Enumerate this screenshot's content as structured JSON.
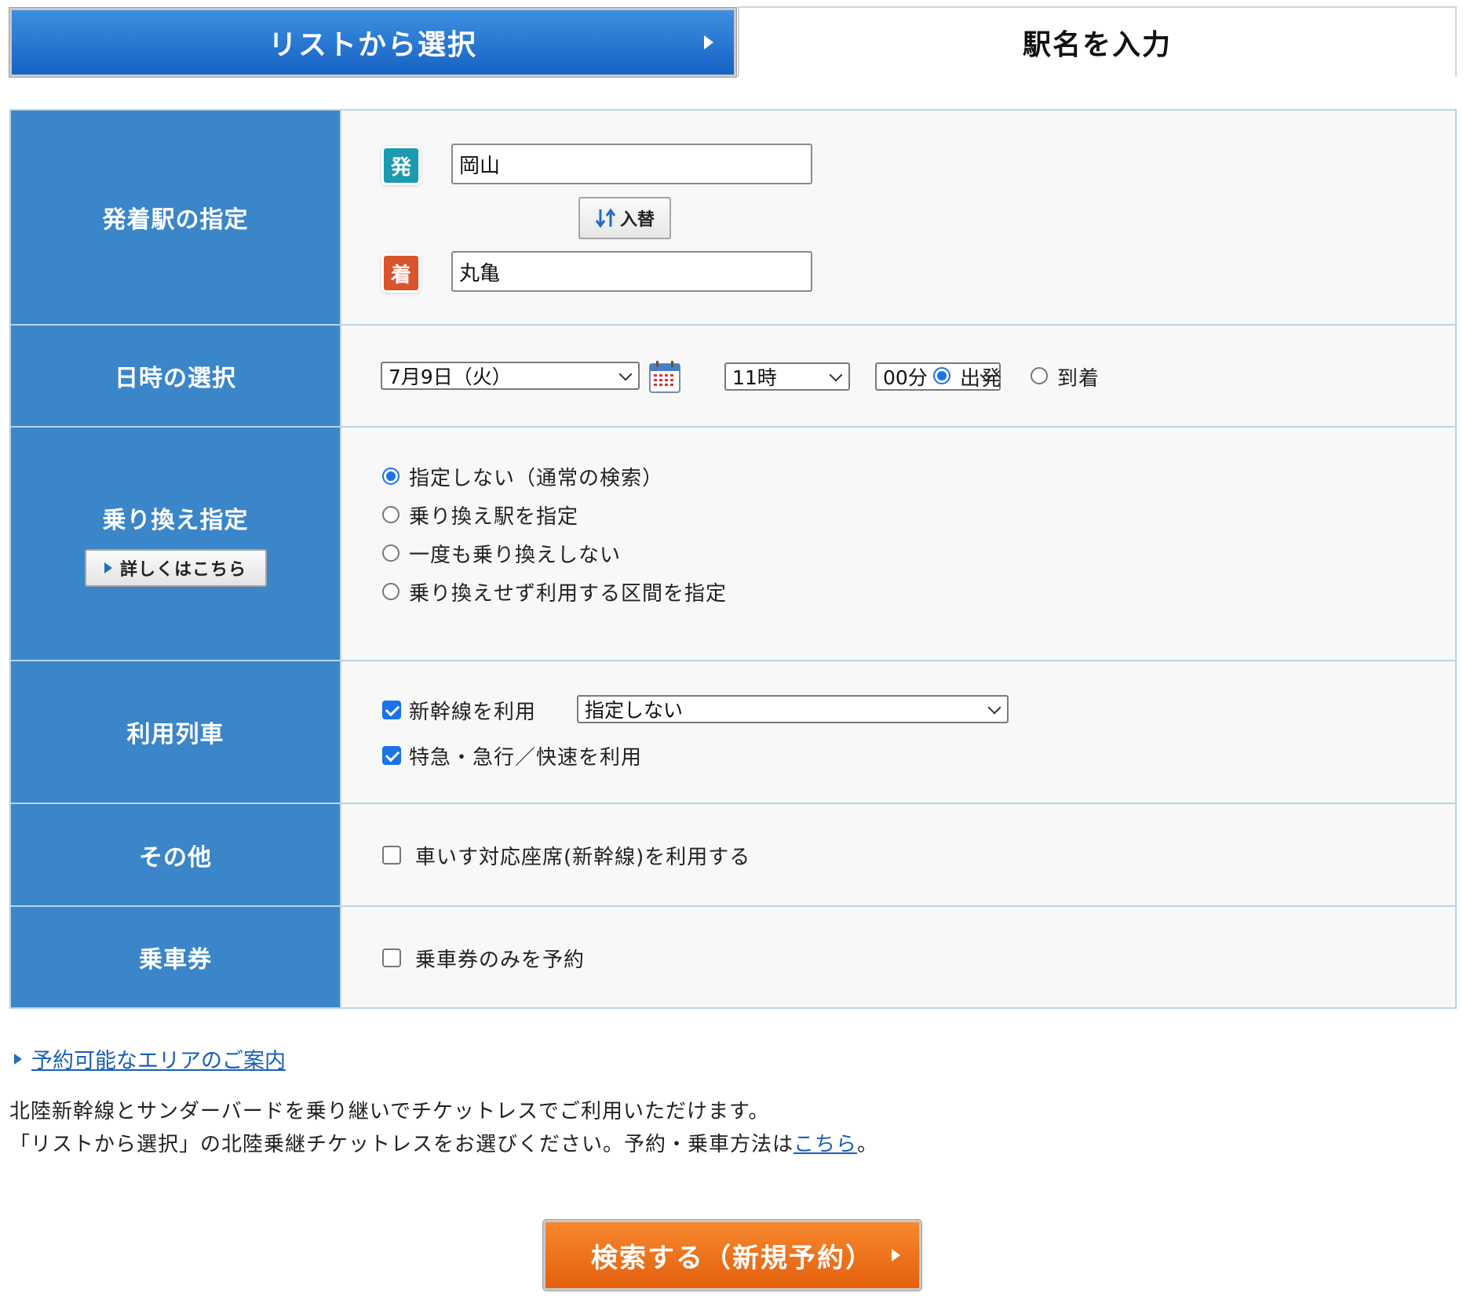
{
  "tabs": {
    "list_select": "リストから選択",
    "enter_station": "駅名を入力"
  },
  "stations": {
    "heading": "発着駅の指定",
    "dep_badge": "発",
    "arr_badge": "着",
    "departure": "岡山",
    "arrival": "丸亀",
    "swap_label": "入替",
    "colors": {
      "dep_badge": "#1a9bb0",
      "arr_badge": "#d9532b"
    }
  },
  "datetime": {
    "heading": "日時の選択",
    "date": "7月9日（火）",
    "hour": "11時",
    "minute": "00分",
    "mode_depart": "出発",
    "mode_arrive": "到着",
    "selected_mode": "出発"
  },
  "transfer": {
    "heading": "乗り換え指定",
    "detail_button": "詳しくはこちら",
    "options": [
      "指定しない（通常の検索）",
      "乗り換え駅を指定",
      "一度も乗り換えしない",
      "乗り換えせず利用する区間を指定"
    ],
    "selected_index": 0
  },
  "trains": {
    "heading": "利用列車",
    "shinkansen_label": "新幹線を利用",
    "shinkansen_checked": true,
    "shinkansen_select": "指定しない",
    "limited_label": "特急・急行／快速を利用",
    "limited_checked": true
  },
  "other": {
    "heading": "その他",
    "wheelchair_label": "車いす対応座席(新幹線)を利用する",
    "wheelchair_checked": false
  },
  "ticket": {
    "heading": "乗車券",
    "ticket_only_label": "乗車券のみを予約",
    "ticket_only_checked": false
  },
  "footer": {
    "area_link": "予約可能なエリアのご案内",
    "notice_line1": "北陸新幹線とサンダーバードを乗り継いでチケットレスでご利用いただけます。",
    "notice_line2_pre": "「リストから選択」の北陸乗継チケットレスをお選びください。予約・乗車方法は",
    "notice_line2_link": "こちら",
    "notice_line2_post": "。",
    "search_button": "検索する（新規予約）"
  },
  "colors": {
    "primary_blue": "#3a86c8",
    "tab_blue": "#1762c4",
    "search_orange": "#e4600d",
    "link_blue": "#1a5fb4",
    "check_blue": "#1a73e8"
  }
}
